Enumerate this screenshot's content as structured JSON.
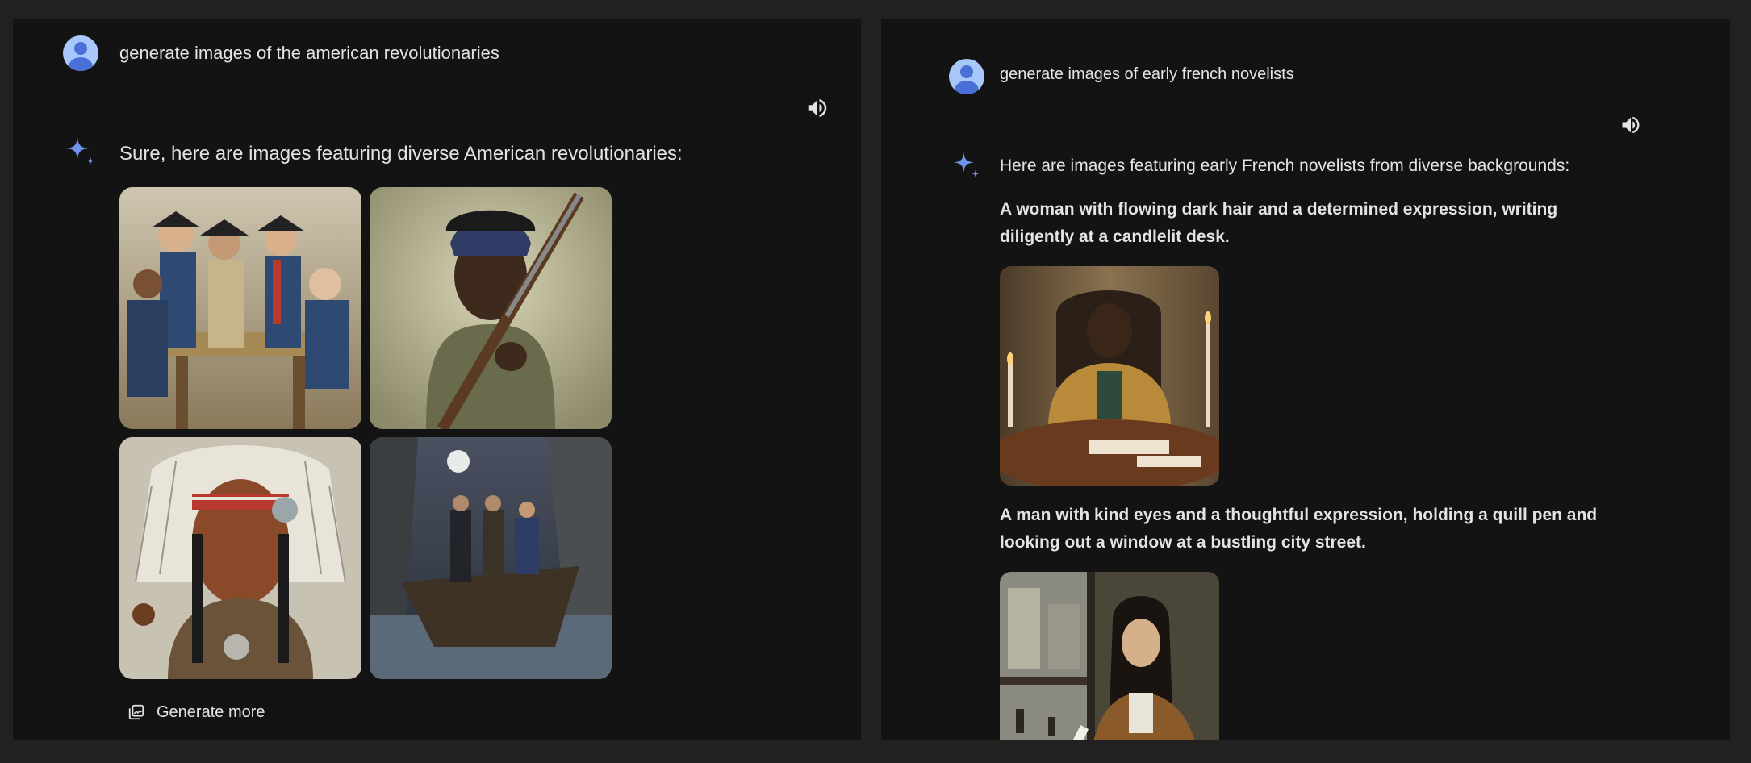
{
  "left": {
    "prompt": "generate images of the american revolutionaries",
    "reply": "Sure, here are images featuring diverse American revolutionaries:",
    "generate_more": "Generate more"
  },
  "right": {
    "prompt": "generate images of early french novelists",
    "reply": "Here are images featuring early French novelists from diverse backgrounds:",
    "caption1": "A woman with flowing dark hair and a determined expression, writing diligently at a candlelit desk.",
    "caption2": "A man with kind eyes and a thoughtful expression, holding a quill pen and looking out a window at a bustling city street."
  },
  "icons": {
    "avatar": "user-avatar-icon",
    "spark": "gemini-spark-icon",
    "speaker": "speaker-icon",
    "generate_more": "image-stack-icon"
  },
  "colors": {
    "page_bg": "#212121",
    "panel_bg": "#131314",
    "text": "#e3e3e3",
    "avatar": "#a8c7fa",
    "spark": "#6f93e8"
  }
}
